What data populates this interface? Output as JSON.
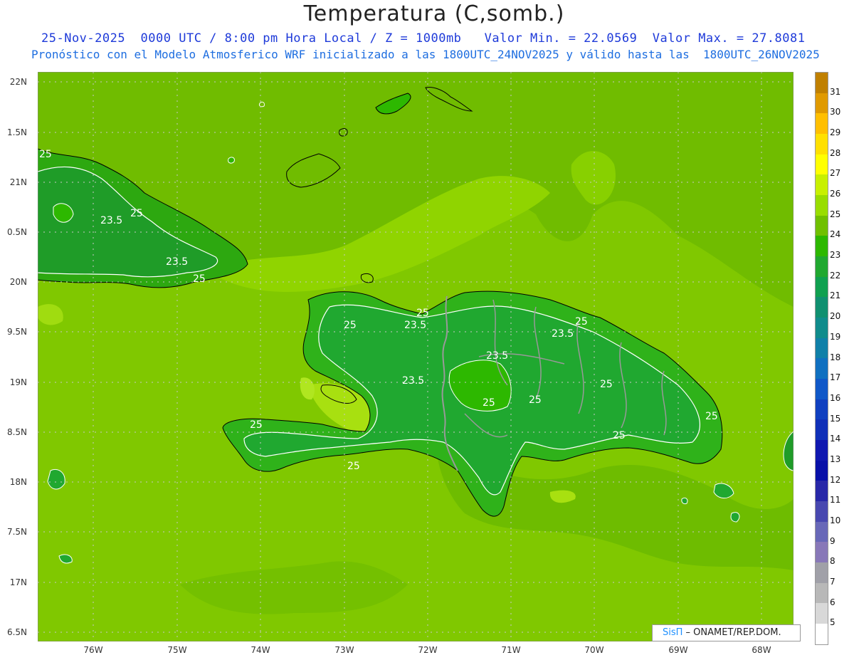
{
  "title": "Temperatura (C,somb.)",
  "subtitle_line1": "25-Nov-2025  0000 UTC / 8:00 pm Hora Local / Z = 1000mb   Valor Min. = 22.0569  Valor Max. = 27.8081",
  "subtitle_line2": "Pronóstico con el Modelo Atmosferico WRF inicializado a las 1800UTC_24NOV2025 y válido hasta las  1800UTC_26NOV2025",
  "lat_labels": [
    "22N",
    "1.5N",
    "21N",
    "0.5N",
    "20N",
    "9.5N",
    "19N",
    "8.5N",
    "18N",
    "7.5N",
    "17N",
    "6.5N"
  ],
  "lon_labels": [
    "76W",
    "75W",
    "74W",
    "73W",
    "72W",
    "71W",
    "70W",
    "69W",
    "68W"
  ],
  "colorbar": {
    "labels": [
      "31",
      "30",
      "29",
      "28",
      "27",
      "26",
      "25",
      "24",
      "23",
      "22",
      "21",
      "20",
      "19",
      "18",
      "17",
      "16",
      "15",
      "14",
      "13",
      "12",
      "11",
      "10",
      "9",
      "8",
      "7",
      "6",
      "5"
    ],
    "colors": [
      "#c08000",
      "#e09a00",
      "#ffbf00",
      "#ffe000",
      "#ffff00",
      "#c8f000",
      "#99dd00",
      "#70c000",
      "#2db800",
      "#20a830",
      "#10a050",
      "#109070",
      "#108c8c",
      "#1080a8",
      "#1070c0",
      "#1058c8",
      "#1040c0",
      "#1030b8",
      "#1018b0",
      "#0810a8",
      "#2828a8",
      "#4848b0",
      "#6868b8",
      "#8878b8",
      "#a0a0a8",
      "#b8b8b8",
      "#d8d8d8",
      "#ffffff"
    ]
  },
  "contour_labels": [
    "25",
    "23.5",
    "25",
    "23.5",
    "25",
    "25",
    "23.5",
    "25",
    "23.5",
    "25",
    "23.5",
    "23.5",
    "25",
    "25",
    "25",
    "25",
    "25",
    "25",
    "25"
  ],
  "credit": {
    "sis": "SisΠ",
    "org": " – ONAMET/REP.DOM."
  },
  "colors": {
    "sea_light": "#8ad000",
    "sea_mid": "#74c000",
    "land_dark": "#1fa800",
    "land_mid": "#2fb21a",
    "yellow_patch": "#a8e010",
    "contour": "#ffffff",
    "border": "#999999",
    "coast": "#000000"
  }
}
